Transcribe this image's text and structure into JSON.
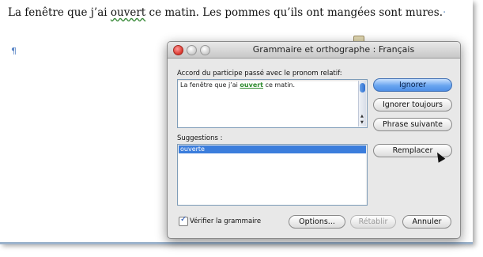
{
  "document": {
    "sentence_before": "La fenêtre que j’ai ",
    "error_word": "ouvert",
    "sentence_after": " ce matin. Les pommes qu’ils ont mangées sont mures.",
    "end_mark": "·",
    "pilcrow": "¶"
  },
  "dialog": {
    "title": "Grammaire et orthographe : Français",
    "issue_label": "Accord du participe passé avec le pronom relatif:",
    "context_before": "La fenêtre que j’ai ",
    "context_error": "ouvert",
    "context_after": " ce matin.",
    "suggestions_label": "Suggestions :",
    "suggestions": [
      "ouverte"
    ],
    "buttons": {
      "ignore": "Ignorer",
      "ignore_all": "Ignorer toujours",
      "next_sentence": "Phrase suivante",
      "replace": "Remplacer",
      "options": "Options...",
      "restore": "Rétablir",
      "cancel": "Annuler"
    },
    "check_grammar_label": "Vérifier la grammaire",
    "check_grammar_checked": true
  },
  "colors": {
    "default_button": "#4f8fe6",
    "error_underline": "#3a8a3a",
    "selection": "#3b7ddc"
  }
}
